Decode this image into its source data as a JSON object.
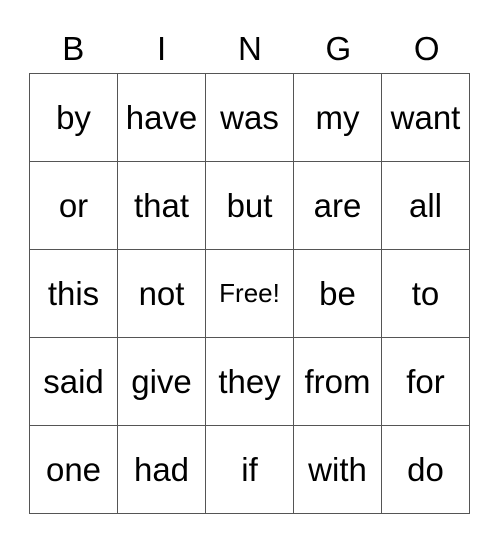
{
  "header": [
    "B",
    "I",
    "N",
    "G",
    "O"
  ],
  "board": [
    [
      "by",
      "have",
      "was",
      "my",
      "want"
    ],
    [
      "or",
      "that",
      "but",
      "are",
      "all"
    ],
    [
      "this",
      "not",
      "Free!",
      "be",
      "to"
    ],
    [
      "said",
      "give",
      "they",
      "from",
      "for"
    ],
    [
      "one",
      "had",
      "if",
      "with",
      "do"
    ]
  ],
  "free_cell": {
    "row": 2,
    "col": 2
  }
}
